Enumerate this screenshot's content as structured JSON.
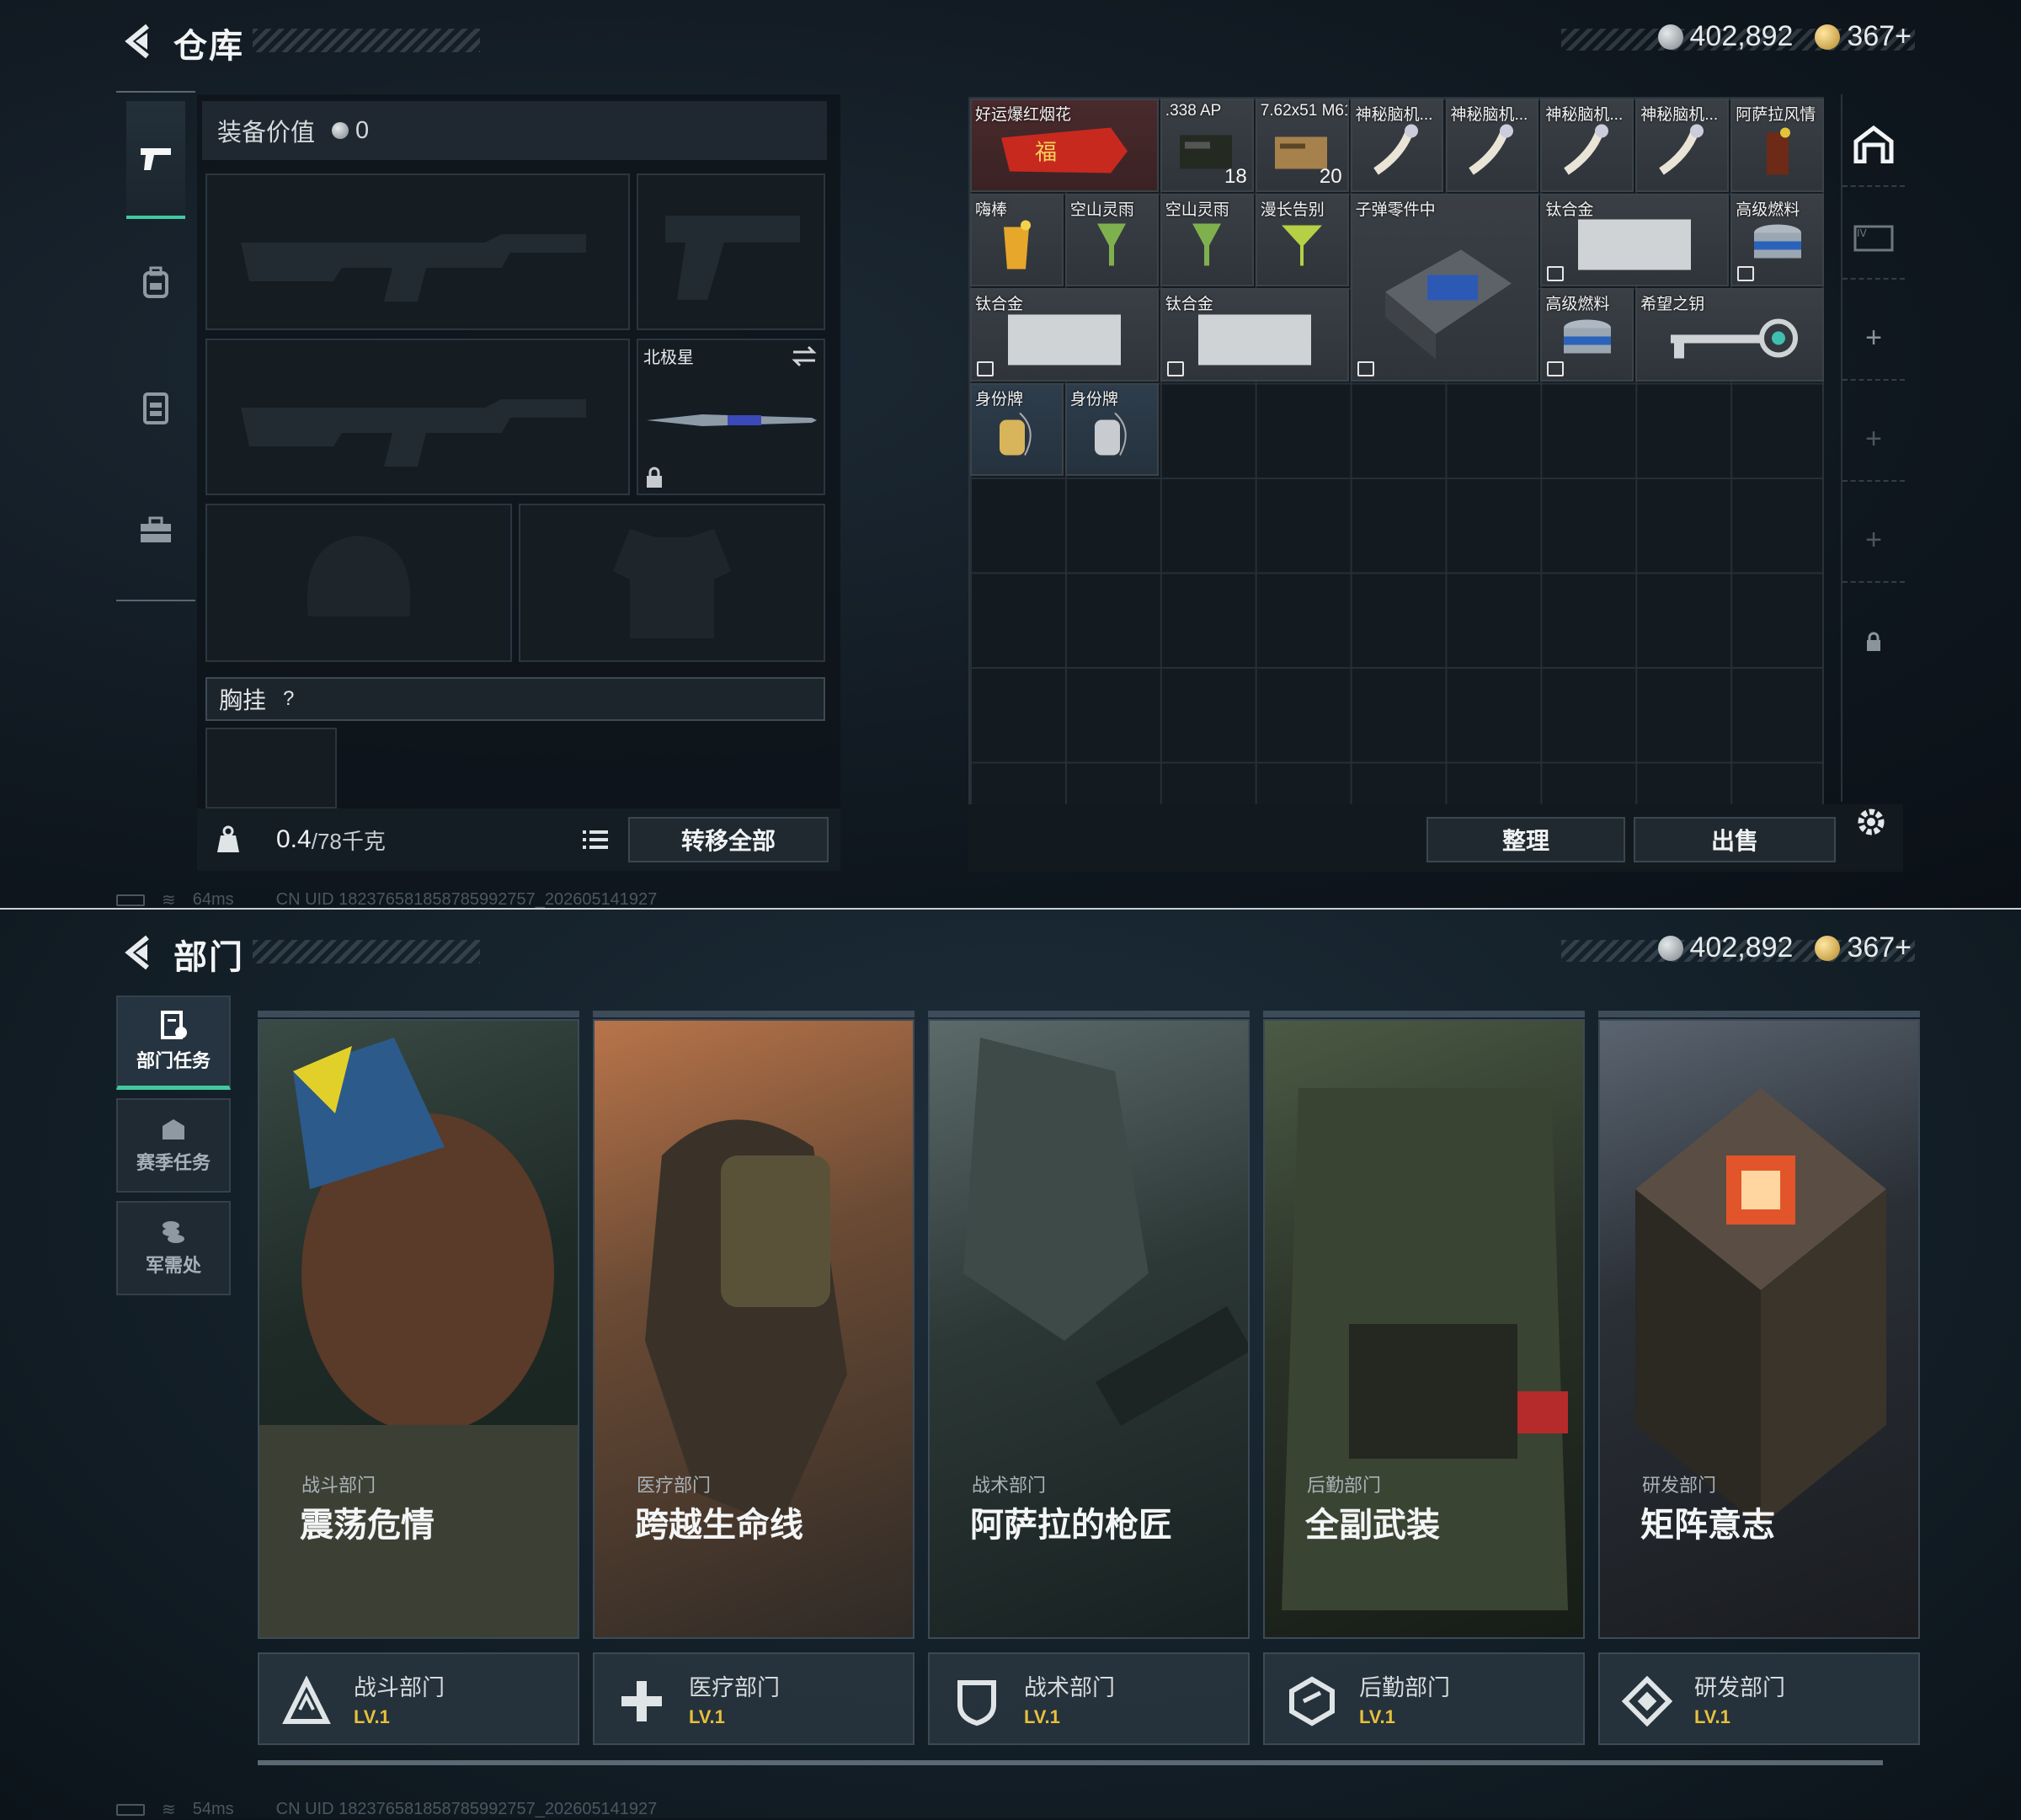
{
  "warehouse": {
    "title": "仓库",
    "currency_silver": "402,892",
    "currency_gold": "367+",
    "equip_value_label": "装备价值",
    "equip_value": "0",
    "knife_slot_label": "北极星",
    "chest_rig_label": "胸挂",
    "help_glyph": "?",
    "weight_current": "0.4",
    "weight_max": "/78千克",
    "transfer_all_button": "转移全部",
    "organize_button": "整理",
    "sell_button": "出售",
    "status_ping": "64ms",
    "status_uid": "CN UID 18237658185878599275­7_202605141927",
    "items": [
      {
        "name": "好运爆红烟花",
        "qty": "",
        "color": "red"
      },
      {
        "name": ".338 AP",
        "qty": "18",
        "color": "gray"
      },
      {
        "name": "7.62x51 M61",
        "qty": "20",
        "color": "gray"
      },
      {
        "name": "神秘脑机...",
        "qty": "",
        "color": "gray"
      },
      {
        "name": "神秘脑机...",
        "qty": "",
        "color": "gray"
      },
      {
        "name": "神秘脑机...",
        "qty": "",
        "color": "gray"
      },
      {
        "name": "神秘脑机...",
        "qty": "",
        "color": "gray"
      },
      {
        "name": "阿萨拉风情",
        "qty": "",
        "color": "gray"
      },
      {
        "name": "嗨棒",
        "qty": "",
        "color": "gray"
      },
      {
        "name": "空山灵雨",
        "qty": "",
        "color": "gray"
      },
      {
        "name": "空山灵雨",
        "qty": "",
        "color": "gray"
      },
      {
        "name": "漫长告别",
        "qty": "",
        "color": "gray"
      },
      {
        "name": "子弹零件中",
        "qty": "",
        "color": "gray"
      },
      {
        "name": "钛合金",
        "qty": "",
        "color": "gray"
      },
      {
        "name": "高级燃料",
        "qty": "",
        "color": "gray"
      },
      {
        "name": "钛合金",
        "qty": "",
        "color": "gray"
      },
      {
        "name": "钛合金",
        "qty": "",
        "color": "gray"
      },
      {
        "name": "高级燃料",
        "qty": "",
        "color": "gray"
      },
      {
        "name": "希望之钥",
        "qty": "",
        "color": "gray"
      },
      {
        "name": "身份牌",
        "qty": "",
        "color": "blue"
      },
      {
        "name": "身份牌",
        "qty": "",
        "color": "blue"
      }
    ]
  },
  "department": {
    "title": "部门",
    "currency_silver": "402,892",
    "currency_gold": "367+",
    "sidebar": [
      {
        "label": "部门任务",
        "icon": "task-doc-icon"
      },
      {
        "label": "赛季任务",
        "icon": "season-icon"
      },
      {
        "label": "军需处",
        "icon": "supply-icon"
      }
    ],
    "status_ping": "54ms",
    "status_uid": "CN UID 18237658185878599275­7_202605141927",
    "cards": [
      {
        "sub": "战斗部门",
        "name": "震荡危情",
        "dept": "战斗部门",
        "level": "LV.1",
        "icon": "combat-dept-icon"
      },
      {
        "sub": "医疗部门",
        "name": "跨越生命线",
        "dept": "医疗部门",
        "level": "LV.1",
        "icon": "medical-dept-icon"
      },
      {
        "sub": "战术部门",
        "name": "阿萨拉的枪匠",
        "dept": "战术部门",
        "level": "LV.1",
        "icon": "tactical-dept-icon"
      },
      {
        "sub": "后勤部门",
        "name": "全副武装",
        "dept": "后勤部门",
        "level": "LV.1",
        "icon": "logistics-dept-icon"
      },
      {
        "sub": "研发部门",
        "name": "矩阵意志",
        "dept": "研发部门",
        "level": "LV.1",
        "icon": "rnd-dept-icon"
      }
    ]
  },
  "colors": {
    "accent": "#41c9a0",
    "level": "#e8c03c"
  }
}
